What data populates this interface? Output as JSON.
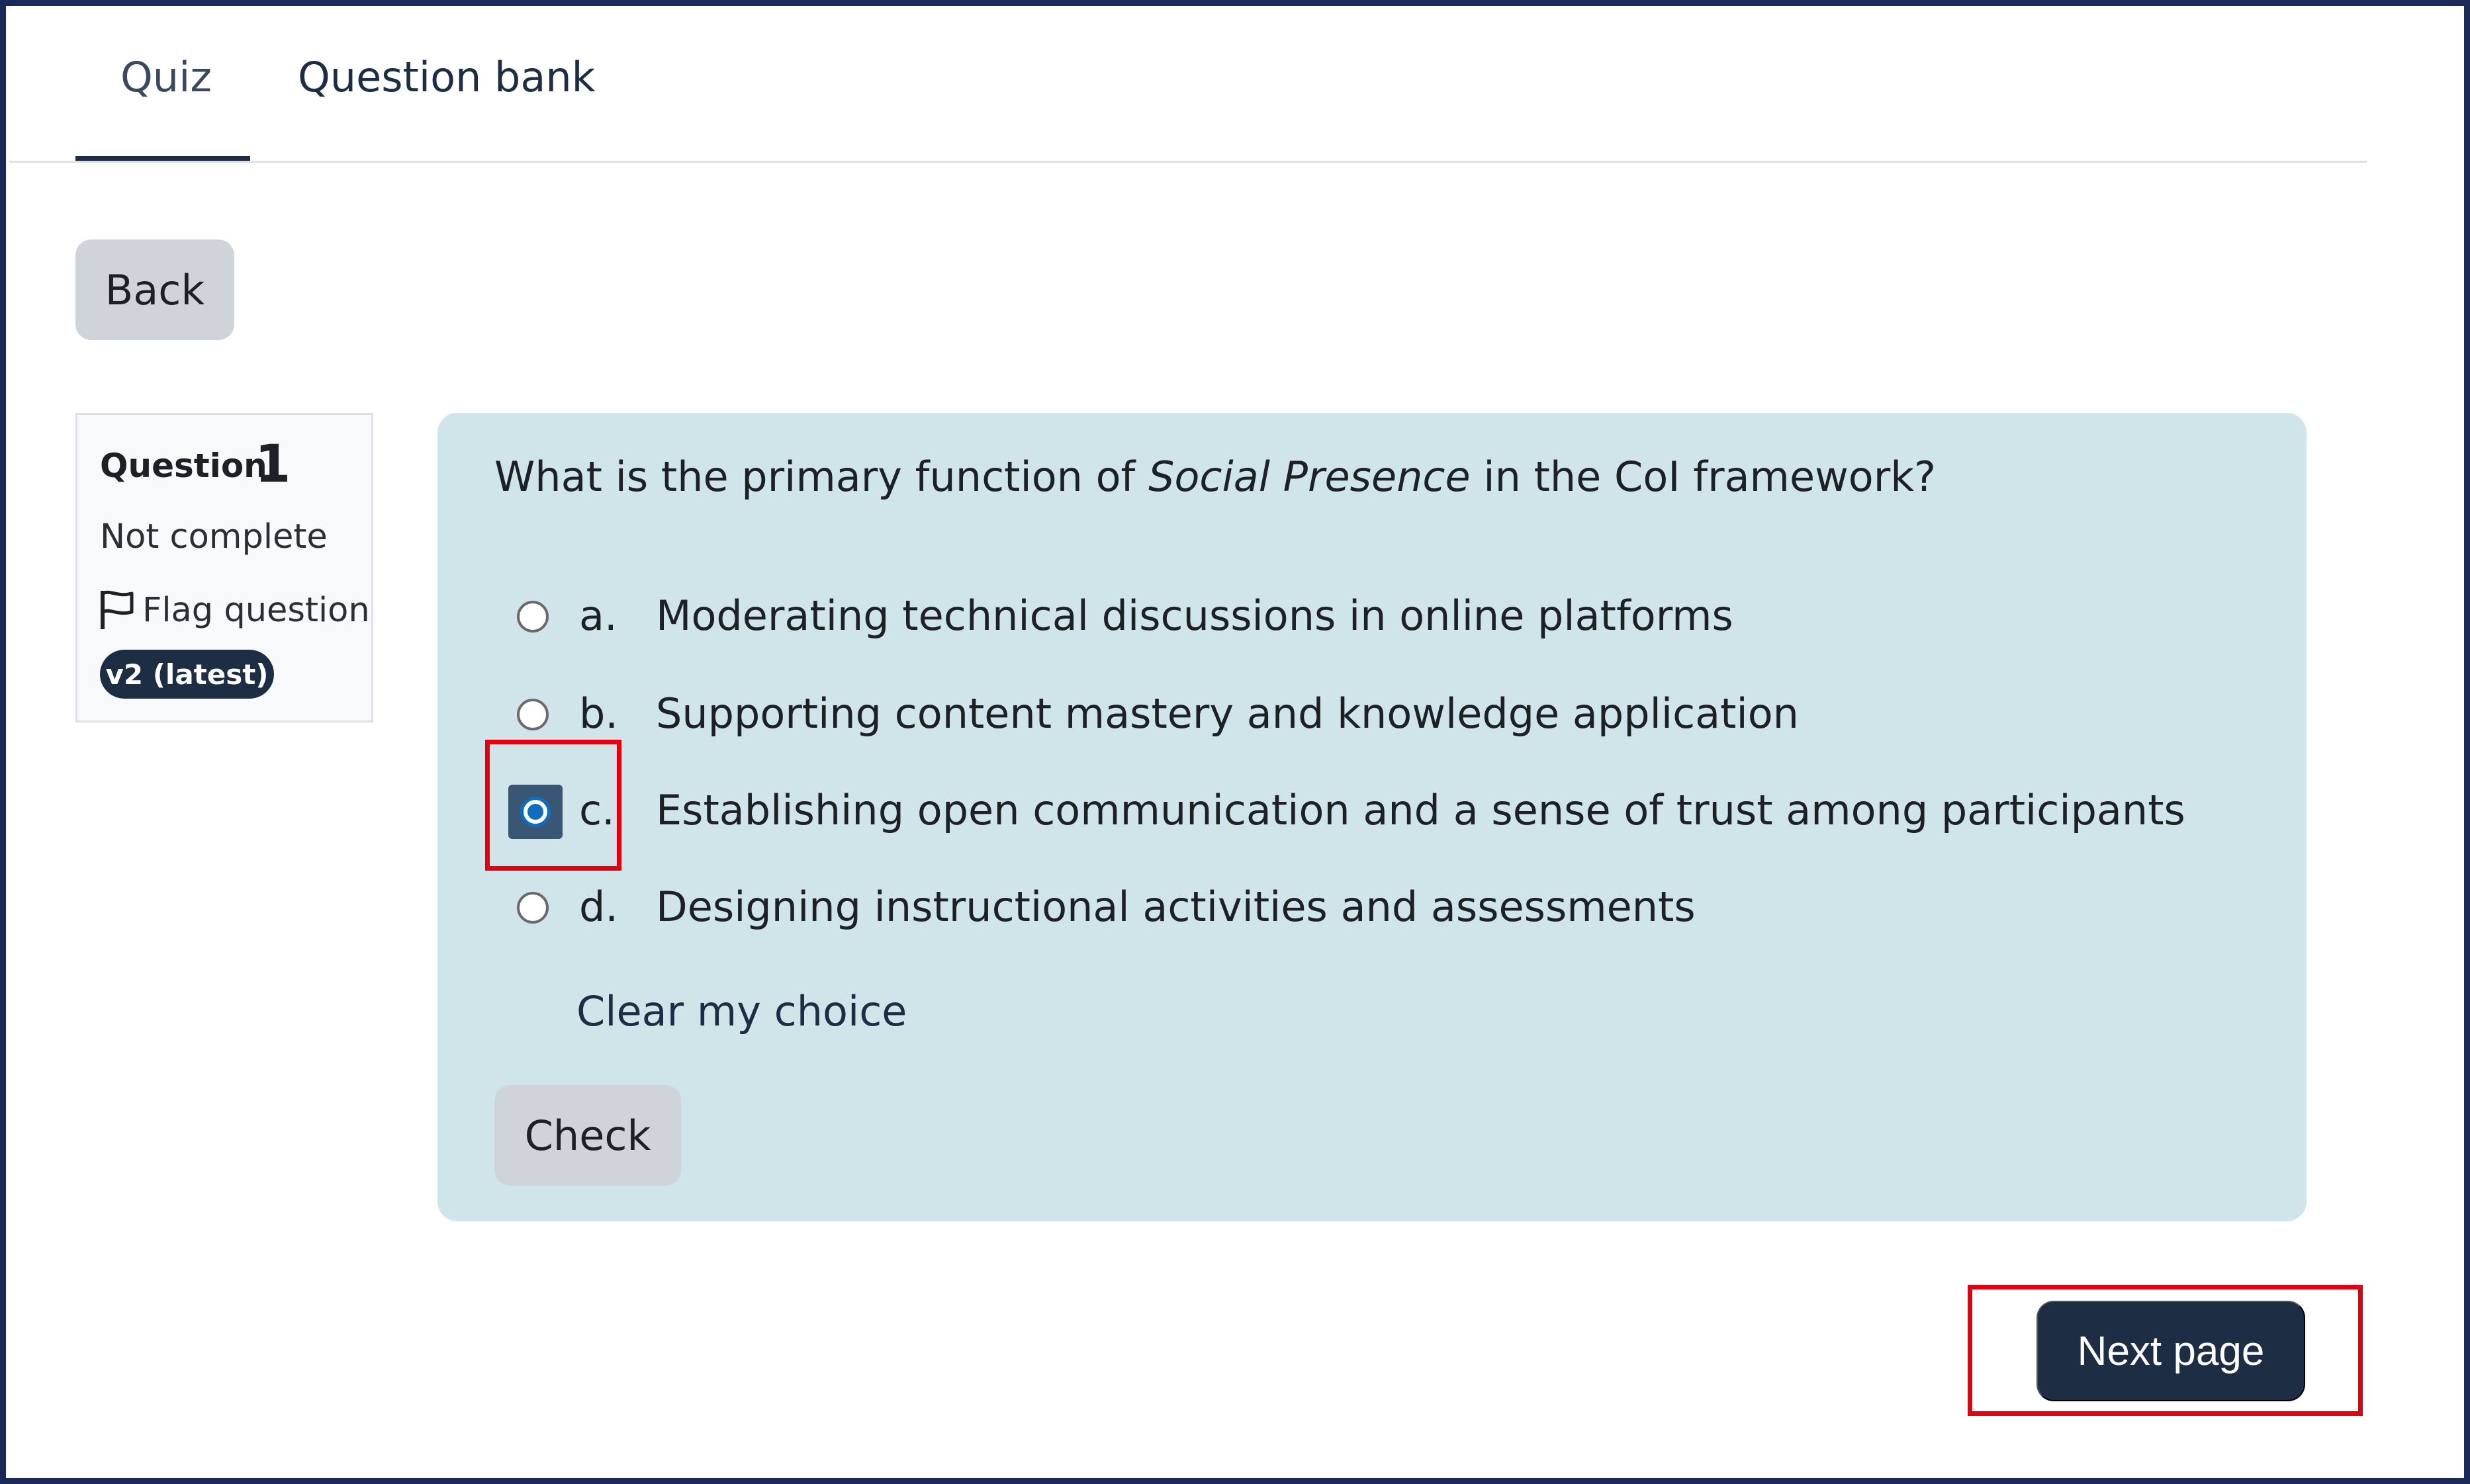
{
  "tabs": [
    {
      "label": "Quiz",
      "active": true
    },
    {
      "label": "Question bank",
      "active": false
    }
  ],
  "back_button": {
    "label": "Back"
  },
  "question_info": {
    "label": "Question",
    "number": "1",
    "state": "Not complete",
    "flag_label": "Flag question",
    "version": "v2 (latest)"
  },
  "question": {
    "text_before": "What is the primary function of ",
    "text_emphasis": "Social Presence",
    "text_after": " in the CoI framework?",
    "answers": [
      {
        "letter": "a.",
        "text": "Moderating technical discussions in online platforms",
        "selected": false
      },
      {
        "letter": "b.",
        "text": "Supporting content mastery and knowledge application",
        "selected": false
      },
      {
        "letter": "c.",
        "text": "Establishing open communication and a sense of trust among participants",
        "selected": true
      },
      {
        "letter": "d.",
        "text": "Designing instructional activities and assessments",
        "selected": false
      }
    ],
    "clear_choice": "Clear my choice",
    "check_button": "Check"
  },
  "next_button": {
    "label": "Next page"
  },
  "colors": {
    "primary_dark": "#1d2d44",
    "content_bg": "#cfe5ea",
    "secondary_button": "#ced4da",
    "highlight": "#e3000f",
    "frame_border": "#1a2957"
  }
}
